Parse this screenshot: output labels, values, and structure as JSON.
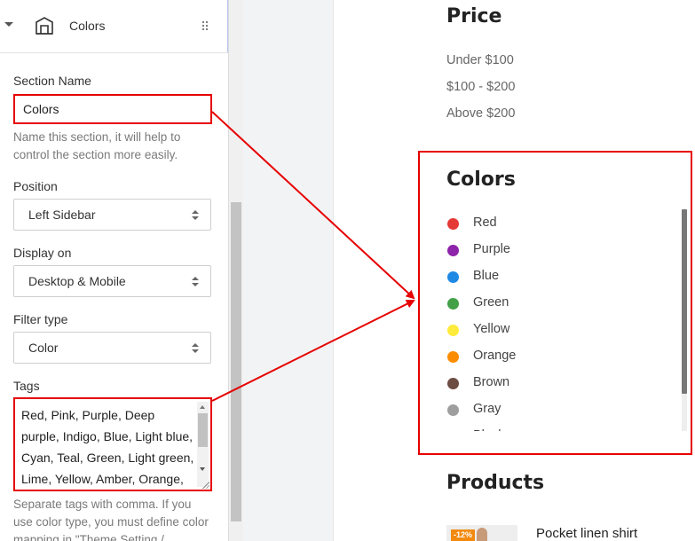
{
  "panel": {
    "header_title": "Colors",
    "section_name": {
      "label": "Section Name",
      "value": "Colors",
      "help": "Name this section, it will help to control the section more easily."
    },
    "position": {
      "label": "Position",
      "value": "Left Sidebar"
    },
    "display_on": {
      "label": "Display on",
      "value": "Desktop & Mobile"
    },
    "filter_type": {
      "label": "Filter type",
      "value": "Color"
    },
    "tags": {
      "label": "Tags",
      "value": "Red, Pink, Purple, Deep purple, Indigo, Blue, Light blue, Cyan, Teal, Green, Light green, Lime, Yellow, Amber, Orange, Deep",
      "help": "Separate tags with comma. If you use color type, you must define color mapping in \"Theme Setting /"
    }
  },
  "preview": {
    "price": {
      "title": "Price",
      "items": [
        "Under $100",
        "$100 - $200",
        "Above $200"
      ]
    },
    "colors": {
      "title": "Colors",
      "items": [
        {
          "name": "Red",
          "color": "#e53935"
        },
        {
          "name": "Purple",
          "color": "#8e24aa"
        },
        {
          "name": "Blue",
          "color": "#1e88e5"
        },
        {
          "name": "Green",
          "color": "#43a047"
        },
        {
          "name": "Yellow",
          "color": "#ffeb3b"
        },
        {
          "name": "Orange",
          "color": "#fb8c00"
        },
        {
          "name": "Brown",
          "color": "#6d4c41"
        },
        {
          "name": "Gray",
          "color": "#9e9e9e"
        },
        {
          "name": "Black",
          "color": "#000000"
        }
      ]
    },
    "products": {
      "title": "Products",
      "items": [
        {
          "name": "Pocket linen shirt",
          "badge": "-12%"
        }
      ]
    }
  },
  "colors": {
    "annotation": "#e60000",
    "accent": "#b9c4ec"
  },
  "icons": {
    "collapse": "caret-down-icon",
    "section": "home-layout-icon",
    "drag": "drag-handle-icon"
  }
}
